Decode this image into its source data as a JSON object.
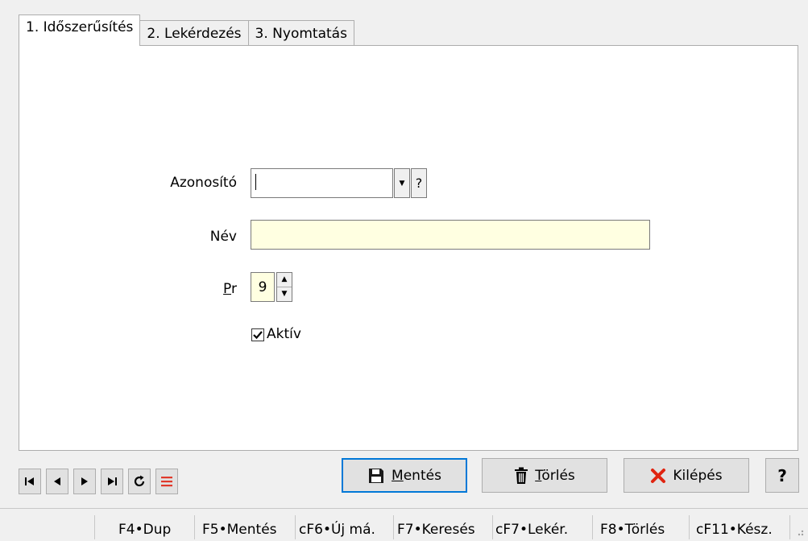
{
  "tabs": [
    {
      "label": "1. Időszerűsítés"
    },
    {
      "label": "2. Lekérdezés"
    },
    {
      "label": "3. Nyomtatás"
    }
  ],
  "form": {
    "azonosito_label": "Azonosító",
    "azonosito_value": "",
    "help_label": "?",
    "nev_label": "Név",
    "nev_value": "",
    "pr_label_underlined": "P",
    "pr_label_rest": "r",
    "pr_value": "9",
    "aktiv_label": "Aktív",
    "aktiv_checked": true
  },
  "buttons": {
    "mentes_underlined": "M",
    "mentes_rest": "entés",
    "torles_underlined": "T",
    "torles_rest": "örlés",
    "kilepes": "Kilépés",
    "help": "?"
  },
  "status_bar": [
    "F4•Dup",
    "F5•Mentés",
    "cF6•Új má.",
    "F7•Keresés",
    "cF7•Lekér.",
    "F8•Törlés",
    "cF11•Kész."
  ]
}
